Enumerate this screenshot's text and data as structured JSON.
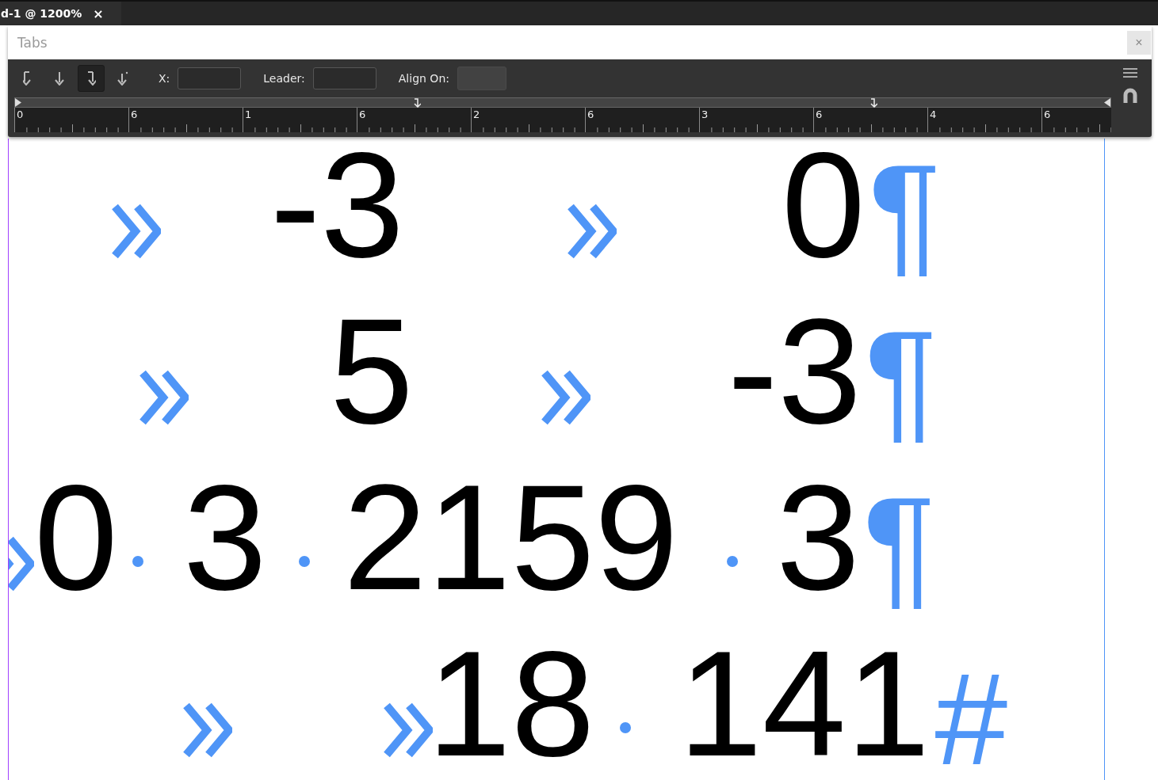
{
  "document_tab": {
    "title": "d-1 @ 1200%",
    "close": "×"
  },
  "panel": {
    "title": "Tabs",
    "close": "×"
  },
  "tab_types": [
    {
      "kind": "left",
      "selected": false
    },
    {
      "kind": "center",
      "selected": false
    },
    {
      "kind": "right",
      "selected": true
    },
    {
      "kind": "decimal",
      "selected": false
    }
  ],
  "fields": [
    {
      "label": "X:",
      "kind": "input"
    },
    {
      "label": "Leader:",
      "kind": "input"
    },
    {
      "label": "Align On:",
      "kind": "disabled"
    }
  ],
  "ruler": {
    "labels": [
      "0",
      "6",
      "1",
      "6",
      "2",
      "6",
      "3",
      "6",
      "4",
      "6"
    ],
    "tab_stops": [
      {
        "kind": "right"
      },
      {
        "kind": "right"
      }
    ]
  },
  "lines": [
    {
      "segments": [
        {
          "kind": "tab"
        },
        {
          "kind": "text",
          "text": "-3"
        },
        {
          "kind": "tab"
        },
        {
          "kind": "text",
          "text": "0"
        },
        {
          "kind": "mark",
          "text": "¶"
        }
      ]
    },
    {
      "segments": [
        {
          "kind": "tab"
        },
        {
          "kind": "text",
          "text": "5"
        },
        {
          "kind": "tab"
        },
        {
          "kind": "text",
          "text": "-3"
        },
        {
          "kind": "mark",
          "text": "¶"
        }
      ]
    },
    {
      "segments": [
        {
          "kind": "tab"
        },
        {
          "kind": "text",
          "text": "0"
        },
        {
          "kind": "space"
        },
        {
          "kind": "text",
          "text": "3"
        },
        {
          "kind": "space"
        },
        {
          "kind": "text",
          "text": "2159"
        },
        {
          "kind": "space"
        },
        {
          "kind": "text",
          "text": "3"
        },
        {
          "kind": "mark",
          "text": "¶"
        }
      ]
    },
    {
      "segments": [
        {
          "kind": "tab"
        },
        {
          "kind": "tab"
        },
        {
          "kind": "text",
          "text": "18"
        },
        {
          "kind": "space"
        },
        {
          "kind": "text",
          "text": "141"
        },
        {
          "kind": "mark",
          "text": "#"
        }
      ]
    }
  ]
}
